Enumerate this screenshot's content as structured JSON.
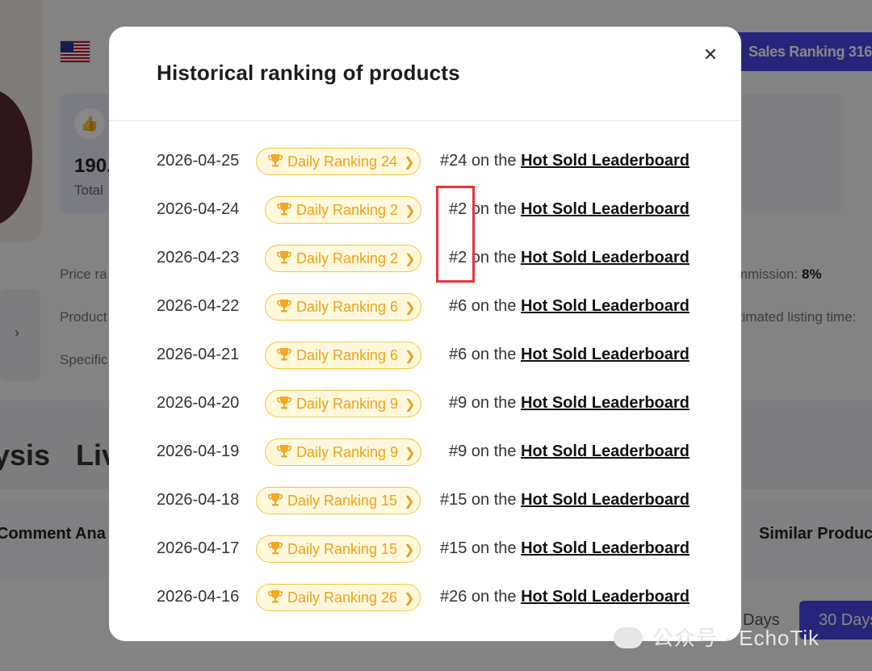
{
  "background": {
    "sales_ranking_label": "Sales Ranking",
    "sales_ranking_value": "316",
    "stat_value": "190.",
    "stat_label": "Total",
    "price_range_label": "Price ra",
    "product_label": "Product",
    "specific_label": "Specific",
    "commission_label": "Commission:",
    "commission_value": "8%",
    "estimated_listing_label": "Estimated listing time:",
    "section_analysis": "ysis",
    "section_live": "Liv",
    "tab_comment": "Comment Ana",
    "tab_similar": "Similar Produc",
    "days_7": "Days",
    "days_30": "30 Days",
    "watermark": "公众号 · EchoTik"
  },
  "modal": {
    "title": "Historical ranking of products",
    "close_icon": "close-icon",
    "rows": [
      {
        "date": "2026-04-25",
        "badge": "Daily Ranking 24",
        "rank": "#24",
        "text": " on the ",
        "link": "Hot Sold Leaderboard"
      },
      {
        "date": "2026-04-24",
        "badge": "Daily Ranking 2",
        "rank": "#2",
        "text": " on the ",
        "link": "Hot Sold Leaderboard"
      },
      {
        "date": "2026-04-23",
        "badge": "Daily Ranking 2",
        "rank": "#2",
        "text": " on the ",
        "link": "Hot Sold Leaderboard"
      },
      {
        "date": "2026-04-22",
        "badge": "Daily Ranking 6",
        "rank": "#6",
        "text": " on the ",
        "link": "Hot Sold Leaderboard"
      },
      {
        "date": "2026-04-21",
        "badge": "Daily Ranking 6",
        "rank": "#6",
        "text": " on the ",
        "link": "Hot Sold Leaderboard"
      },
      {
        "date": "2026-04-20",
        "badge": "Daily Ranking 9",
        "rank": "#9",
        "text": " on the ",
        "link": "Hot Sold Leaderboard"
      },
      {
        "date": "2026-04-19",
        "badge": "Daily Ranking 9",
        "rank": "#9",
        "text": " on the ",
        "link": "Hot Sold Leaderboard"
      },
      {
        "date": "2026-04-18",
        "badge": "Daily Ranking 15",
        "rank": "#15",
        "text": " on the ",
        "link": "Hot Sold Leaderboard"
      },
      {
        "date": "2026-04-17",
        "badge": "Daily Ranking 15",
        "rank": "#15",
        "text": " on the ",
        "link": "Hot Sold Leaderboard"
      },
      {
        "date": "2026-04-16",
        "badge": "Daily Ranking 26",
        "rank": "#26",
        "text": " on the ",
        "link": "Hot Sold Leaderboard"
      }
    ]
  },
  "colors": {
    "accent": "#4b47e8",
    "badge_text": "#f0a11c",
    "badge_border": "#f3c73b",
    "highlight_box": "#e8333c"
  }
}
